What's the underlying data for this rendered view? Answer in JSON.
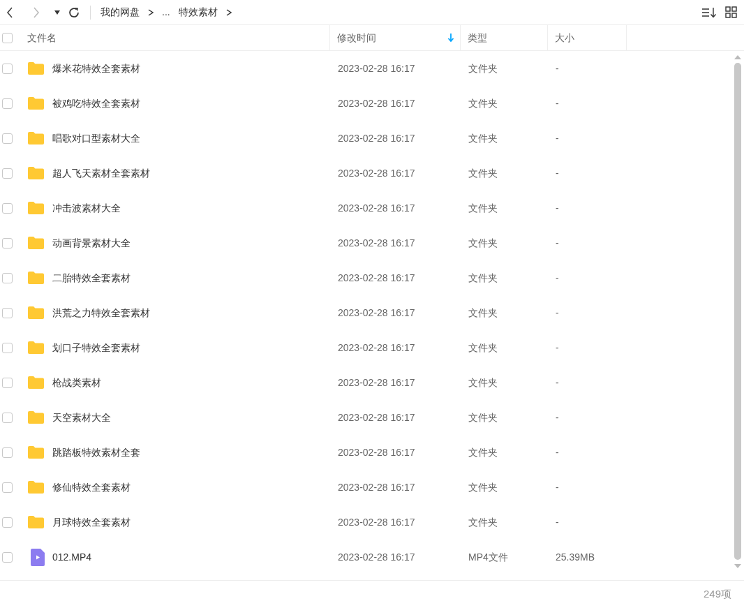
{
  "breadcrumb": [
    "我的网盘",
    "...",
    "特效素材"
  ],
  "header": {
    "checked": false,
    "columns": [
      {
        "label": "文件名",
        "sorted": false
      },
      {
        "label": "修改时间",
        "sorted": true
      },
      {
        "label": "类型",
        "sorted": false
      },
      {
        "label": "大小",
        "sorted": false
      }
    ]
  },
  "rows": [
    {
      "kind": "folder",
      "name": "爆米花特效全套素材",
      "modified": "2023-02-28 16:17",
      "type": "文件夹",
      "size": "-",
      "checked": false
    },
    {
      "kind": "folder",
      "name": "被鸡吃特效全套素材",
      "modified": "2023-02-28 16:17",
      "type": "文件夹",
      "size": "-",
      "checked": false
    },
    {
      "kind": "folder",
      "name": "唱歌对口型素材大全",
      "modified": "2023-02-28 16:17",
      "type": "文件夹",
      "size": "-",
      "checked": false
    },
    {
      "kind": "folder",
      "name": "超人飞天素材全套素材",
      "modified": "2023-02-28 16:17",
      "type": "文件夹",
      "size": "-",
      "checked": false
    },
    {
      "kind": "folder",
      "name": "冲击波素材大全",
      "modified": "2023-02-28 16:17",
      "type": "文件夹",
      "size": "-",
      "checked": false
    },
    {
      "kind": "folder",
      "name": "动画背景素材大全",
      "modified": "2023-02-28 16:17",
      "type": "文件夹",
      "size": "-",
      "checked": false
    },
    {
      "kind": "folder",
      "name": "二胎特效全套素材",
      "modified": "2023-02-28 16:17",
      "type": "文件夹",
      "size": "-",
      "checked": false
    },
    {
      "kind": "folder",
      "name": "洪荒之力特效全套素材",
      "modified": "2023-02-28 16:17",
      "type": "文件夹",
      "size": "-",
      "checked": false
    },
    {
      "kind": "folder",
      "name": "划口子特效全套素材",
      "modified": "2023-02-28 16:17",
      "type": "文件夹",
      "size": "-",
      "checked": false
    },
    {
      "kind": "folder",
      "name": "枪战类素材",
      "modified": "2023-02-28 16:17",
      "type": "文件夹",
      "size": "-",
      "checked": false
    },
    {
      "kind": "folder",
      "name": "天空素材大全",
      "modified": "2023-02-28 16:17",
      "type": "文件夹",
      "size": "-",
      "checked": false
    },
    {
      "kind": "folder",
      "name": "跳踏板特效素材全套",
      "modified": "2023-02-28 16:17",
      "type": "文件夹",
      "size": "-",
      "checked": false
    },
    {
      "kind": "folder",
      "name": "修仙特效全套素材",
      "modified": "2023-02-28 16:17",
      "type": "文件夹",
      "size": "-",
      "checked": false
    },
    {
      "kind": "folder",
      "name": "月球特效全套素材",
      "modified": "2023-02-28 16:17",
      "type": "文件夹",
      "size": "-",
      "checked": false
    },
    {
      "kind": "video",
      "name": "012.MP4",
      "modified": "2023-02-28 16:17",
      "type": "MP4文件",
      "size": "25.39MB",
      "checked": false
    }
  ],
  "status_bar": {
    "count": "249项"
  }
}
